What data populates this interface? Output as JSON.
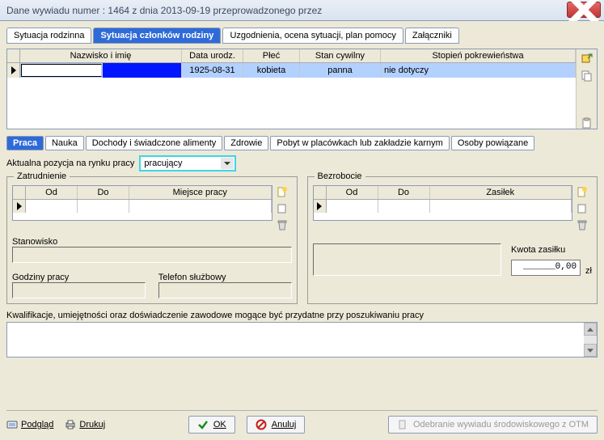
{
  "window": {
    "title": "Dane wywiadu numer : 1464 z dnia 2013-09-19 przeprowadzonego przez"
  },
  "top_tabs": [
    "Sytuacja rodzinna",
    "Sytuacja członków rodziny",
    "Uzgodnienia, ocena sytuacji, plan pomocy",
    "Załączniki"
  ],
  "top_tabs_selected": 1,
  "grid": {
    "headers": [
      "Nazwisko i imię",
      "Data urodz.",
      "Płeć",
      "Stan cywilny",
      "Stopień pokrewieństwa"
    ],
    "row": {
      "name": "",
      "birth": "1925-08-31",
      "sex": "kobieta",
      "marital": "panna",
      "kinship": "nie dotyczy"
    }
  },
  "inner_tabs": [
    "Praca",
    "Nauka",
    "Dochody i świadczone alimenty",
    "Zdrowie",
    "Pobyt w placówkach lub zakładzie karnym",
    "Osoby powiązane"
  ],
  "inner_tabs_selected": 0,
  "labor": {
    "label": "Aktualna pozycja na rynku pracy",
    "value": "pracujący"
  },
  "employment": {
    "legend": "Zatrudnienie",
    "headers": [
      "Od",
      "Do",
      "Miejsce pracy"
    ],
    "position_label": "Stanowisko",
    "hours_label": "Godziny pracy",
    "phone_label": "Telefon służbowy"
  },
  "unemployment": {
    "legend": "Bezrobocie",
    "headers": [
      "Od",
      "Do",
      "Zasiłek"
    ],
    "amount_label": "Kwota zasiłku",
    "amount_value": "______0,00",
    "amount_unit": "zł"
  },
  "qualifications": {
    "label": "Kwalifikacje, umiejętności oraz doświadczenie zawodowe mogące być przydatne przy poszukiwaniu pracy"
  },
  "buttons": {
    "preview": "Podgląd",
    "print": "Drukuj",
    "ok": "OK",
    "cancel": "Anuluj",
    "receive": "Odebranie wywiadu środowiskowego z OTM"
  }
}
